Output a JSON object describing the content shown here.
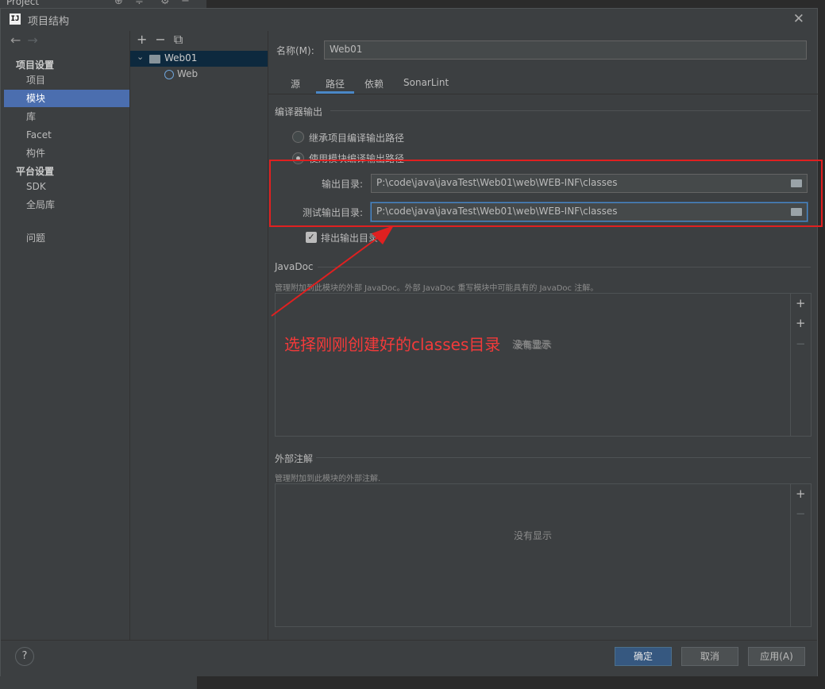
{
  "background": {
    "project_label": "Project"
  },
  "dialog": {
    "app_icon_text": "IJ",
    "title": "项目结构",
    "close_glyph": "✕"
  },
  "nav": {
    "back": "←",
    "forward": "→",
    "group1": "项目设置",
    "items1": [
      "项目",
      "模块",
      "库",
      "Facet",
      "构件"
    ],
    "selected": "模块",
    "group2": "平台设置",
    "items2": [
      "SDK",
      "全局库"
    ],
    "problems": "问题"
  },
  "tree": {
    "add": "+",
    "remove": "−",
    "copy": "⧉",
    "root": "Web01",
    "child": "Web"
  },
  "main": {
    "name_label": "名称(M):",
    "name_value": "Web01",
    "tabs": [
      "源",
      "路径",
      "依赖",
      "SonarLint"
    ],
    "active_tab": "路径",
    "compiler_output_title": "编译器输出",
    "radio_inherit": "继承项目编译输出路径",
    "radio_module": "使用模块编译输出路径",
    "output_dir_label": "输出目录:",
    "output_dir_value": "P:\\code\\java\\javaTest\\Web01\\web\\WEB-INF\\classes",
    "test_output_dir_label": "测试输出目录:",
    "test_output_dir_value": "P:\\code\\java\\javaTest\\Web01\\web\\WEB-INF\\classes",
    "exclude_output": "排出输出目录",
    "javadoc_title": "JavaDoc",
    "javadoc_desc": "管理附加到此模块的外部 JavaDoc。外部 JavaDoc 重写模块中可能具有的 JavaDoc 注解。",
    "javadoc_empty": "没有显示",
    "ext_ann_title": "外部注解",
    "ext_ann_desc": "管理附加到此模块的外部注解.",
    "ext_ann_empty": "没有显示",
    "add_glyph": "+",
    "remove_glyph": "−"
  },
  "footer": {
    "help": "?",
    "ok": "确定",
    "cancel": "取消",
    "apply": "应用(A)"
  },
  "annotation": {
    "text": "选择刚刚创建好的classes目录",
    "color": "#f23a3a"
  }
}
